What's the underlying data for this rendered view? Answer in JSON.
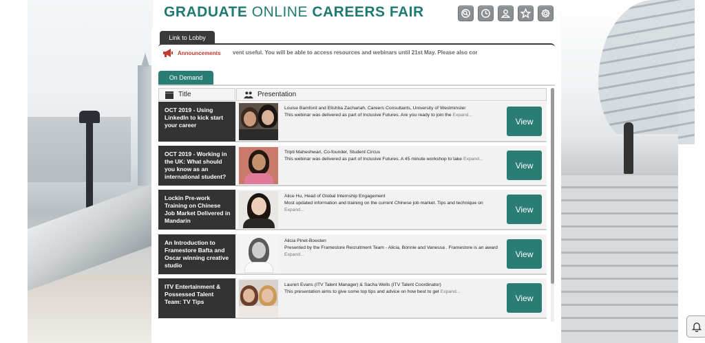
{
  "header": {
    "title_part1": "GRADUATE",
    "title_part2": "ONLINE",
    "title_part3": "CAREERS FAIR"
  },
  "toolbar": {
    "icons": [
      "search-icon",
      "clock-icon",
      "user-icon",
      "star-icon",
      "gear-icon"
    ]
  },
  "tabs": {
    "lobby": "Link to Lobby",
    "on_demand": "On Demand"
  },
  "announcements": {
    "label": "Announcements",
    "ticker": "vent useful. You will be able to access resources and webinars until 21st May. Please also cor"
  },
  "table": {
    "col_title": "Title",
    "col_presentation": "Presentation",
    "rows": [
      {
        "title": "OCT 2019 - Using LinkedIn to kick start your career",
        "presenter": "Louise Bamford and Elishba Zachariah, Careers Consultants, University of Westminster",
        "desc": "This webinar was delivered as part of Inclusive Futures. Are you ready to join the",
        "expand": "Expand...",
        "view": "View"
      },
      {
        "title": "OCT 2019 - Working in the UK: What should you know as an international student?",
        "presenter": "Tripti Maheshwari, Co-founder, Student Circus",
        "desc": "This webinar was delivered as part of Inclusive Futures. A 45 minute workshop to take",
        "expand": "Expand...",
        "view": "View"
      },
      {
        "title": "Lockin Pre-work Training on Chinese Job Market Delivered in Mandarin",
        "presenter": "Alice Hu, Head of Global Internship Engagement",
        "desc": "Most updated information and training on the current Chinese job market. Tips and technique on",
        "expand": "Expand...",
        "view": "View"
      },
      {
        "title": "An Introduction to Framestore Bafta and Oscar winning creative studio",
        "presenter": "Alicia Pinet-Boesten",
        "desc": "Presented by the Framestore Recruitment Team - Alicia, Bonnie and Vanessa . Framestore is an award",
        "expand": "Expand...",
        "view": "View"
      },
      {
        "title": "ITV Entertainment & Possessed Talent Team: TV Tips",
        "presenter": "Lauren Evans (ITV Talent Manager) & Sacha Wells (ITV Talent Coordinator)",
        "desc": "This presentation aims to give some top tips and advice on how best to get",
        "expand": "Expand...",
        "view": "View"
      }
    ]
  },
  "colors": {
    "brand_teal": "#2a7d74",
    "dark_cell": "#333333",
    "announcement_red": "#c0392b"
  }
}
